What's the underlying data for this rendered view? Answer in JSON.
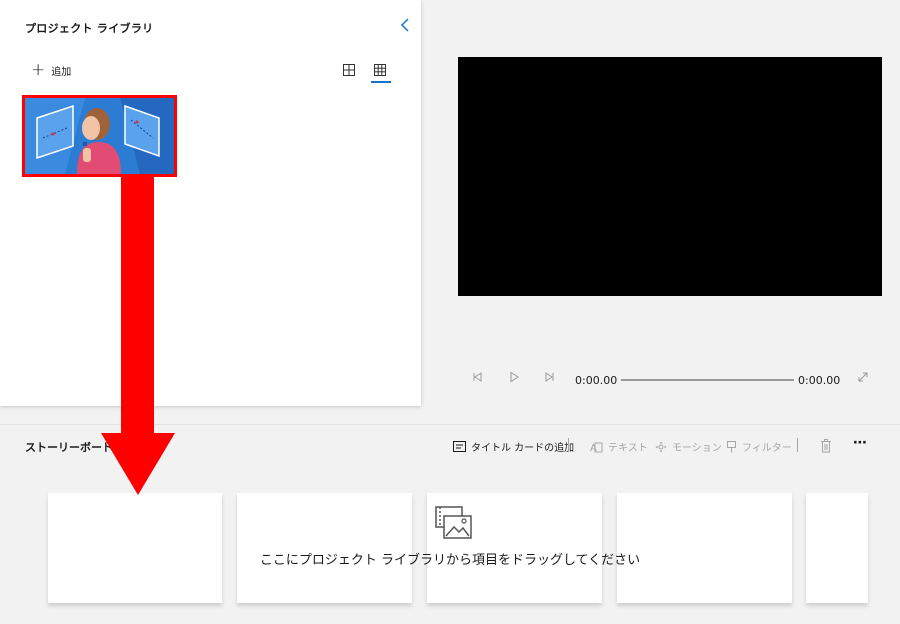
{
  "library": {
    "title": "プロジェクト ライブラリ",
    "add_label": "追加",
    "collapse_icon": "chevron-left-icon",
    "view_large_icon": "grid-large-icon",
    "view_small_icon": "grid-small-icon",
    "selected_view": "small"
  },
  "preview": {
    "time_current": "0:00.00",
    "time_total": "0:00.00",
    "progress": 0
  },
  "storyboard": {
    "title": "ストーリーボード",
    "toolbar": {
      "title_card": "タイトル カードの追加",
      "text": "テキスト",
      "motion": "モーション",
      "filter": "フィルター",
      "more": "⋯"
    },
    "drop_hint": "ここにプロジェクト ライブラリから項目をドラッグしてください"
  },
  "colors": {
    "accent": "#1a73c8",
    "annotation_red": "#ff0000"
  }
}
